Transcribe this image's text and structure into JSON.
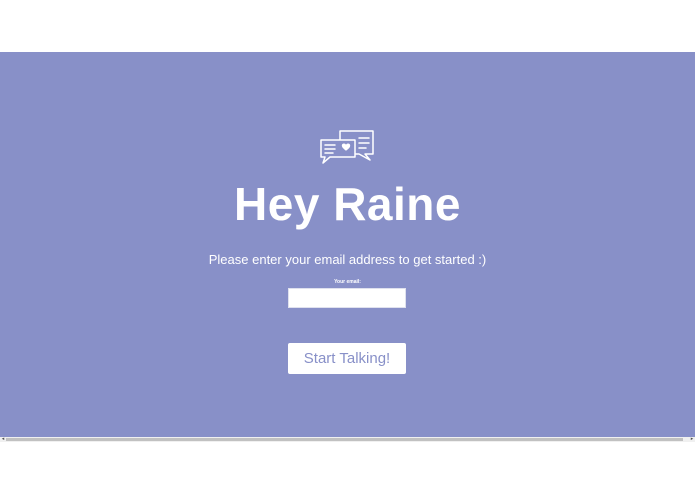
{
  "icon": "chat-bubbles-heart-icon",
  "hero": {
    "title": "Hey Raine",
    "subtitle": "Please enter your email address to get started :)",
    "background_color": "#8890c8"
  },
  "form": {
    "email_label": "Your email:",
    "email_value": "",
    "email_placeholder": "",
    "submit_label": "Start Talking!"
  },
  "scrollbar": {
    "left_arrow": "◂",
    "right_arrow": "▸"
  }
}
